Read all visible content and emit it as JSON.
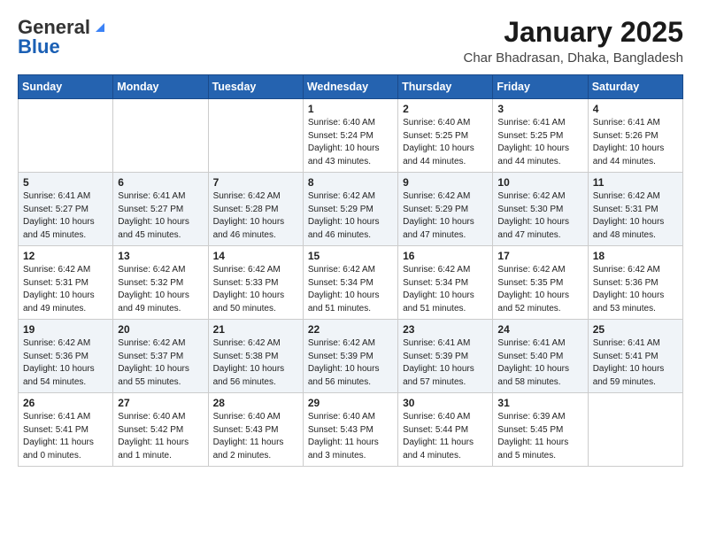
{
  "header": {
    "logo_general": "General",
    "logo_blue": "Blue",
    "month_title": "January 2025",
    "location": "Char Bhadrasan, Dhaka, Bangladesh"
  },
  "weekdays": [
    "Sunday",
    "Monday",
    "Tuesday",
    "Wednesday",
    "Thursday",
    "Friday",
    "Saturday"
  ],
  "weeks": [
    [
      {
        "day": "",
        "info": ""
      },
      {
        "day": "",
        "info": ""
      },
      {
        "day": "",
        "info": ""
      },
      {
        "day": "1",
        "info": "Sunrise: 6:40 AM\nSunset: 5:24 PM\nDaylight: 10 hours\nand 43 minutes."
      },
      {
        "day": "2",
        "info": "Sunrise: 6:40 AM\nSunset: 5:25 PM\nDaylight: 10 hours\nand 44 minutes."
      },
      {
        "day": "3",
        "info": "Sunrise: 6:41 AM\nSunset: 5:25 PM\nDaylight: 10 hours\nand 44 minutes."
      },
      {
        "day": "4",
        "info": "Sunrise: 6:41 AM\nSunset: 5:26 PM\nDaylight: 10 hours\nand 44 minutes."
      }
    ],
    [
      {
        "day": "5",
        "info": "Sunrise: 6:41 AM\nSunset: 5:27 PM\nDaylight: 10 hours\nand 45 minutes."
      },
      {
        "day": "6",
        "info": "Sunrise: 6:41 AM\nSunset: 5:27 PM\nDaylight: 10 hours\nand 45 minutes."
      },
      {
        "day": "7",
        "info": "Sunrise: 6:42 AM\nSunset: 5:28 PM\nDaylight: 10 hours\nand 46 minutes."
      },
      {
        "day": "8",
        "info": "Sunrise: 6:42 AM\nSunset: 5:29 PM\nDaylight: 10 hours\nand 46 minutes."
      },
      {
        "day": "9",
        "info": "Sunrise: 6:42 AM\nSunset: 5:29 PM\nDaylight: 10 hours\nand 47 minutes."
      },
      {
        "day": "10",
        "info": "Sunrise: 6:42 AM\nSunset: 5:30 PM\nDaylight: 10 hours\nand 47 minutes."
      },
      {
        "day": "11",
        "info": "Sunrise: 6:42 AM\nSunset: 5:31 PM\nDaylight: 10 hours\nand 48 minutes."
      }
    ],
    [
      {
        "day": "12",
        "info": "Sunrise: 6:42 AM\nSunset: 5:31 PM\nDaylight: 10 hours\nand 49 minutes."
      },
      {
        "day": "13",
        "info": "Sunrise: 6:42 AM\nSunset: 5:32 PM\nDaylight: 10 hours\nand 49 minutes."
      },
      {
        "day": "14",
        "info": "Sunrise: 6:42 AM\nSunset: 5:33 PM\nDaylight: 10 hours\nand 50 minutes."
      },
      {
        "day": "15",
        "info": "Sunrise: 6:42 AM\nSunset: 5:34 PM\nDaylight: 10 hours\nand 51 minutes."
      },
      {
        "day": "16",
        "info": "Sunrise: 6:42 AM\nSunset: 5:34 PM\nDaylight: 10 hours\nand 51 minutes."
      },
      {
        "day": "17",
        "info": "Sunrise: 6:42 AM\nSunset: 5:35 PM\nDaylight: 10 hours\nand 52 minutes."
      },
      {
        "day": "18",
        "info": "Sunrise: 6:42 AM\nSunset: 5:36 PM\nDaylight: 10 hours\nand 53 minutes."
      }
    ],
    [
      {
        "day": "19",
        "info": "Sunrise: 6:42 AM\nSunset: 5:36 PM\nDaylight: 10 hours\nand 54 minutes."
      },
      {
        "day": "20",
        "info": "Sunrise: 6:42 AM\nSunset: 5:37 PM\nDaylight: 10 hours\nand 55 minutes."
      },
      {
        "day": "21",
        "info": "Sunrise: 6:42 AM\nSunset: 5:38 PM\nDaylight: 10 hours\nand 56 minutes."
      },
      {
        "day": "22",
        "info": "Sunrise: 6:42 AM\nSunset: 5:39 PM\nDaylight: 10 hours\nand 56 minutes."
      },
      {
        "day": "23",
        "info": "Sunrise: 6:41 AM\nSunset: 5:39 PM\nDaylight: 10 hours\nand 57 minutes."
      },
      {
        "day": "24",
        "info": "Sunrise: 6:41 AM\nSunset: 5:40 PM\nDaylight: 10 hours\nand 58 minutes."
      },
      {
        "day": "25",
        "info": "Sunrise: 6:41 AM\nSunset: 5:41 PM\nDaylight: 10 hours\nand 59 minutes."
      }
    ],
    [
      {
        "day": "26",
        "info": "Sunrise: 6:41 AM\nSunset: 5:41 PM\nDaylight: 11 hours\nand 0 minutes."
      },
      {
        "day": "27",
        "info": "Sunrise: 6:40 AM\nSunset: 5:42 PM\nDaylight: 11 hours\nand 1 minute."
      },
      {
        "day": "28",
        "info": "Sunrise: 6:40 AM\nSunset: 5:43 PM\nDaylight: 11 hours\nand 2 minutes."
      },
      {
        "day": "29",
        "info": "Sunrise: 6:40 AM\nSunset: 5:43 PM\nDaylight: 11 hours\nand 3 minutes."
      },
      {
        "day": "30",
        "info": "Sunrise: 6:40 AM\nSunset: 5:44 PM\nDaylight: 11 hours\nand 4 minutes."
      },
      {
        "day": "31",
        "info": "Sunrise: 6:39 AM\nSunset: 5:45 PM\nDaylight: 11 hours\nand 5 minutes."
      },
      {
        "day": "",
        "info": ""
      }
    ]
  ]
}
